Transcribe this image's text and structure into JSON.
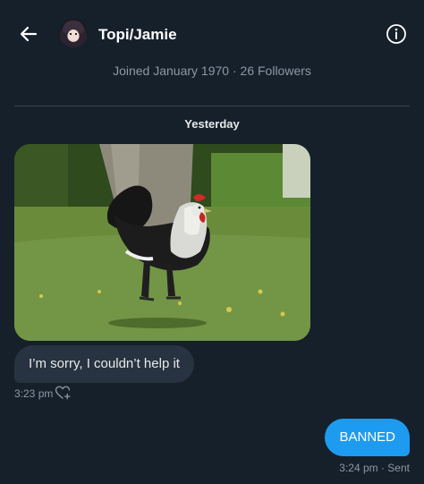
{
  "header": {
    "title": "Topi/Jamie",
    "back_icon": "back-arrow-icon",
    "info_icon": "info-icon"
  },
  "profile": {
    "joined": "Joined January 1970",
    "separator": "·",
    "followers": "26 Followers"
  },
  "conversation": {
    "day_label": "Yesterday",
    "messages": [
      {
        "type": "image",
        "description_icon": "rooster-photo"
      },
      {
        "type": "text",
        "direction": "incoming",
        "text": "I’m sorry, I couldn’t help it",
        "time": "3:23 pm",
        "reaction_icon": "add-reaction-heart-icon"
      },
      {
        "type": "text",
        "direction": "outgoing",
        "text": "BANNED",
        "time_status": "3:24 pm · Sent"
      }
    ]
  },
  "colors": {
    "background": "#15202b",
    "incoming_bubble": "#273340",
    "outgoing_bubble": "#1d9bf0",
    "muted_text": "#8b98a5"
  }
}
